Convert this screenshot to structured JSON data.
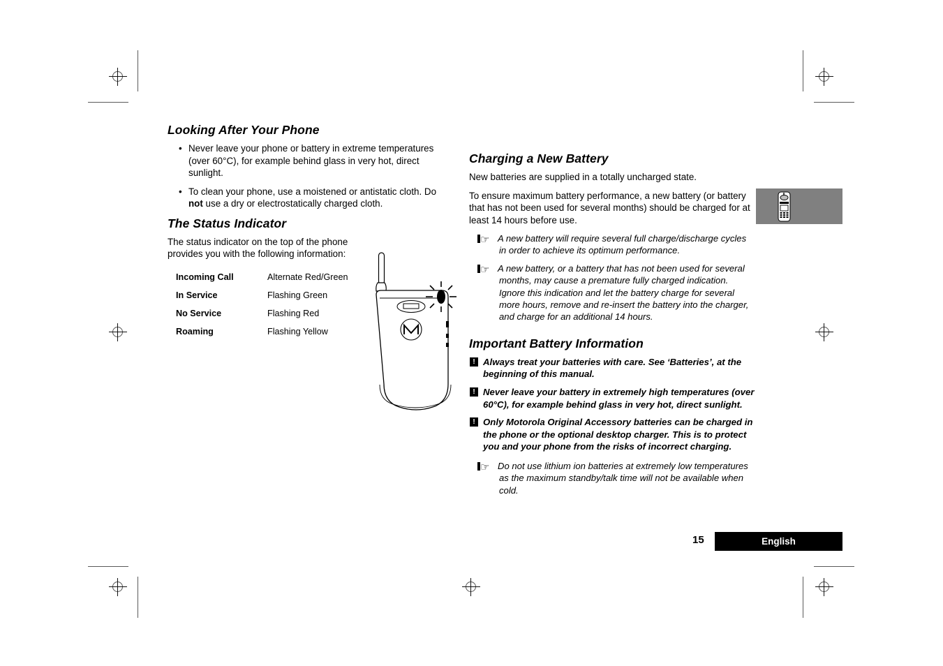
{
  "page": {
    "number": "15",
    "language": "English"
  },
  "left_column": {
    "looking_after": {
      "heading": "Looking After Your Phone",
      "bullet_char": "•",
      "bullets": [
        {
          "text": "Never leave your phone or battery in extreme temperatures (over 60°C), for example behind glass in very hot, direct sunlight."
        },
        {
          "pre": "To clean your phone, use a moistened or antistatic cloth. Do ",
          "bold": "not",
          "post": " use a dry or electrostatically charged cloth."
        }
      ]
    },
    "status_indicator": {
      "heading": "The Status Indicator",
      "intro": "The status indicator on the top of the phone provides you with the following information:",
      "rows": [
        {
          "label": "Incoming Call",
          "value": "Alternate Red/Green"
        },
        {
          "label": "In Service",
          "value": "Flashing Green"
        },
        {
          "label": "No Service",
          "value": "Flashing Red"
        },
        {
          "label": "Roaming",
          "value": "Flashing Yellow"
        }
      ]
    }
  },
  "right_column": {
    "charging": {
      "heading": "Charging a New Battery",
      "paragraphs": [
        "New batteries are supplied in a totally uncharged state.",
        "To ensure maximum battery performance, a new battery (or battery that has not been used for several months) should be charged for at least 14 hours before use."
      ],
      "notes": [
        "A new battery will require several full charge/discharge cycles in order to achieve its optimum performance.",
        "A new battery, or a battery that has not been used for several months, may cause a premature fully charged indication. Ignore this indication and let the battery charge for several more hours, remove and re-insert the battery into the charger, and charge for an additional 14 hours."
      ]
    },
    "important_battery": {
      "heading": "Important Battery Information",
      "warning_icon_char": "!",
      "warnings": [
        "Always treat your batteries with care. See ‘Batteries’, at the beginning of this manual.",
        "Never leave your battery in extremely high temperatures (over 60°C), for example behind glass in very hot, direct sunlight.",
        "Only Motorola Original Accessory batteries can be charged in the phone or the optional desktop charger. This is to protect you and your phone from the risks of incorrect charging."
      ],
      "notes": [
        "Do not use lithium ion batteries at extremely low temperatures as the maximum standby/talk time will not be available when cold."
      ]
    }
  },
  "icons": {
    "note_hand": "☞",
    "phone_front": "phone-front-illustration",
    "chapter_tab_phone": "flip-phone-icon"
  },
  "colors": {
    "chapter_tab_background": "#808080",
    "language_bar_background": "#000000",
    "text": "#000000"
  }
}
